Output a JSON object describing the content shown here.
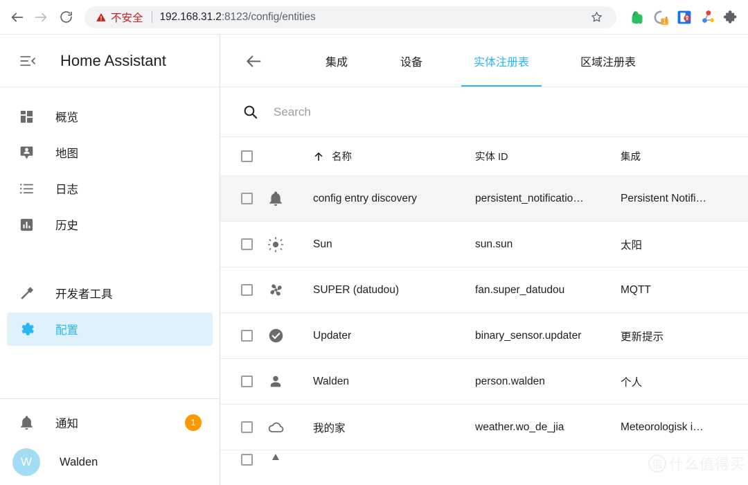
{
  "browser": {
    "back_label": "Back",
    "forward_label": "Forward",
    "reload_label": "Reload",
    "security_warning": "不安全",
    "url_host": "192.168.31.2",
    "url_path": ":8123/config/entities",
    "bookmark_label": "Bookmark this tab",
    "extensions": [
      {
        "name": "evernote-extension-icon",
        "color": "#2dbe60"
      },
      {
        "name": "sync-pending-extension-icon",
        "color": "#9aa0a6",
        "badge": "1",
        "badge_color": "#f5a623"
      },
      {
        "name": "password-manager-extension-icon",
        "color": "#1a73e8"
      },
      {
        "name": "molecule-extension-icon",
        "color": "#ea4335"
      },
      {
        "name": "extensions-puzzle-icon",
        "color": "#5f6368"
      }
    ]
  },
  "sidebar": {
    "title": "Home Assistant",
    "menu_icon": "menu-collapse-icon",
    "items": [
      {
        "label": "概览",
        "icon": "dashboard-icon",
        "active": false
      },
      {
        "label": "地图",
        "icon": "map-marker-account-icon",
        "active": false
      },
      {
        "label": "日志",
        "icon": "format-list-bulleted-icon",
        "active": false
      },
      {
        "label": "历史",
        "icon": "chart-box-icon",
        "active": false
      }
    ],
    "tools": [
      {
        "label": "开发者工具",
        "icon": "hammer-wrench-icon",
        "active": false
      },
      {
        "label": "配置",
        "icon": "cog-icon",
        "active": true
      }
    ],
    "notifications": {
      "label": "通知",
      "icon": "bell-icon",
      "badge": "1",
      "badge_color": "#ff9800"
    },
    "user": {
      "name": "Walden",
      "initial": "W",
      "avatar_color": "#a4dcf5"
    },
    "active_color": "#29b6f6",
    "active_bg": "#dff1fb"
  },
  "main": {
    "back_button": "back-arrow",
    "tabs": [
      {
        "label": "集成",
        "active": false
      },
      {
        "label": "设备",
        "active": false
      },
      {
        "label": "实体注册表",
        "active": true
      },
      {
        "label": "区域注册表",
        "active": false
      }
    ],
    "search": {
      "placeholder": "Search",
      "value": "",
      "icon": "search-icon"
    },
    "table": {
      "columns": [
        {
          "key": "check",
          "label": ""
        },
        {
          "key": "icon",
          "label": ""
        },
        {
          "key": "name",
          "label": "名称",
          "sorted": true,
          "sort_dir": "asc"
        },
        {
          "key": "entity_id",
          "label": "实体 ID"
        },
        {
          "key": "integration",
          "label": "集成"
        }
      ],
      "rows": [
        {
          "icon": "bell-icon",
          "name": "config entry discovery",
          "entity_id": "persistent_notificatio…",
          "integration": "Persistent Notifi…",
          "selected": true
        },
        {
          "icon": "sun-icon",
          "name": "Sun",
          "entity_id": "sun.sun",
          "integration": "太阳",
          "selected": false
        },
        {
          "icon": "fan-icon",
          "name": "SUPER (datudou)",
          "entity_id": "fan.super_datudou",
          "integration": "MQTT",
          "selected": false
        },
        {
          "icon": "check-circle-icon",
          "name": "Updater",
          "entity_id": "binary_sensor.updater",
          "integration": "更新提示",
          "selected": false
        },
        {
          "icon": "account-icon",
          "name": "Walden",
          "entity_id": "person.walden",
          "integration": "个人",
          "selected": false
        },
        {
          "icon": "cloud-icon",
          "name": "我的家",
          "entity_id": "weather.wo_de_jia",
          "integration": "Meteorologisk i…",
          "selected": false
        }
      ]
    }
  },
  "watermark": {
    "mark": "值",
    "text": "什么值得买"
  }
}
